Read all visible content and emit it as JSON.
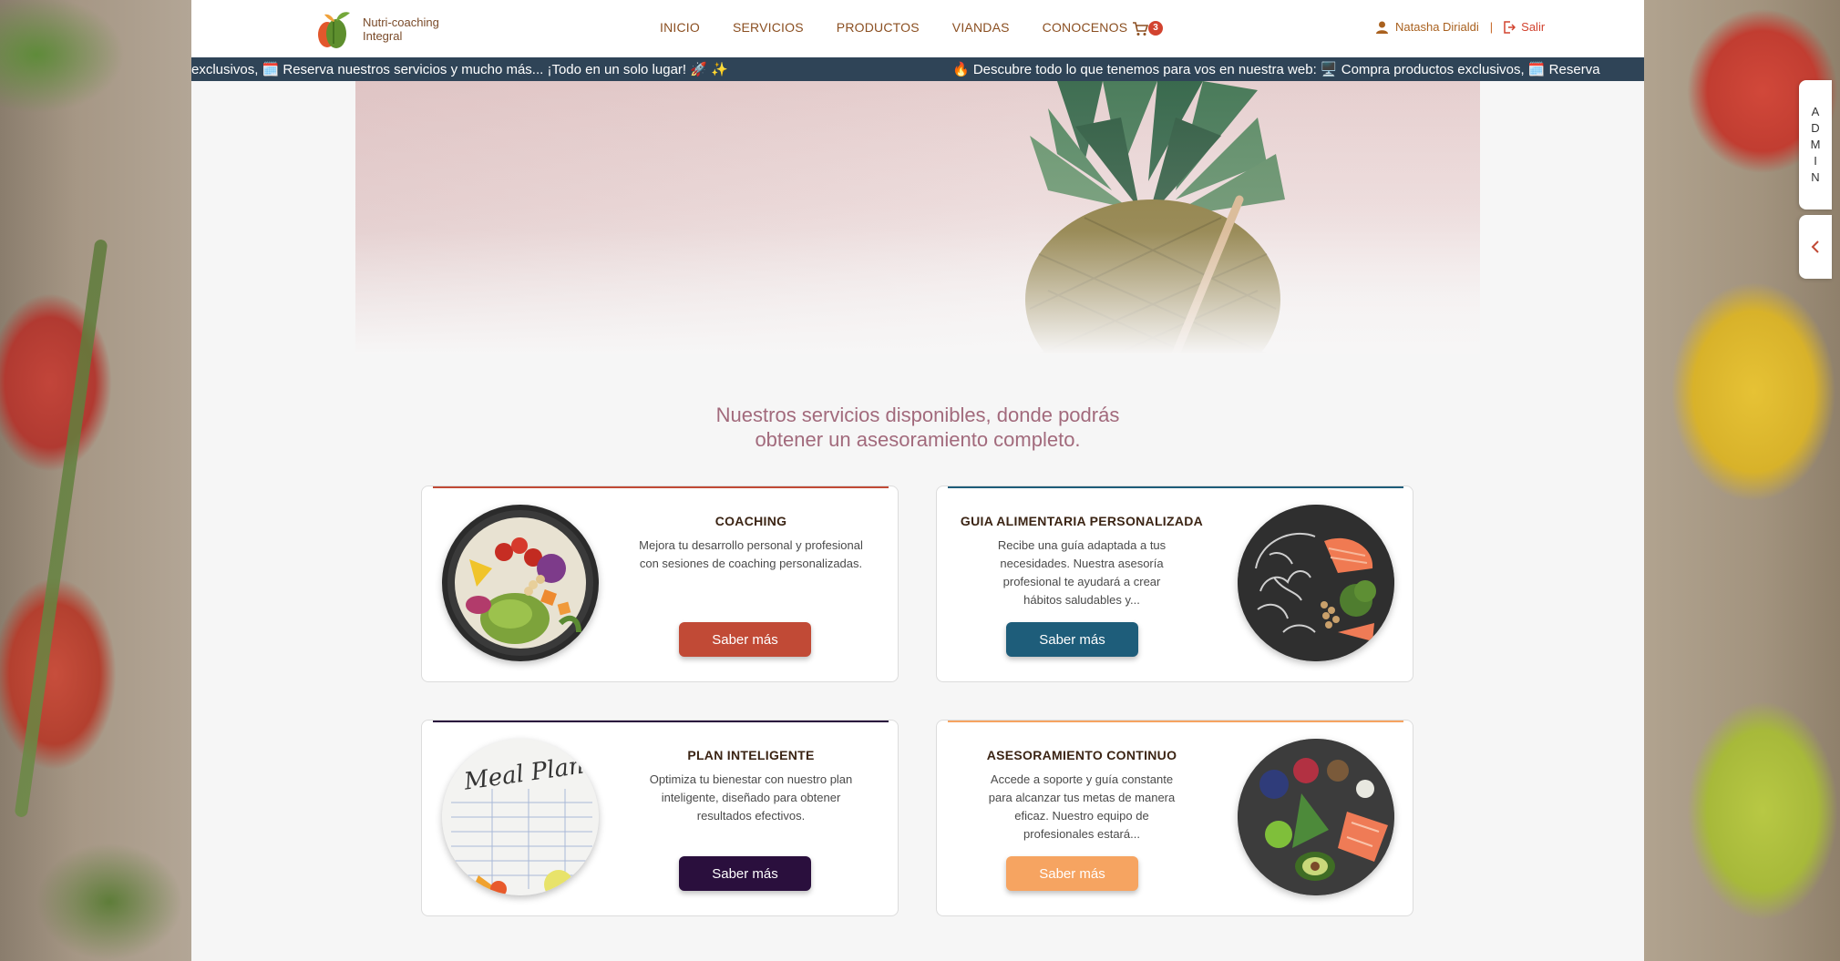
{
  "brand": {
    "name_line1": "Nutri-coaching",
    "name_line2": "Integral"
  },
  "nav": {
    "items": [
      {
        "label": "INICIO"
      },
      {
        "label": "SERVICIOS"
      },
      {
        "label": "PRODUCTOS"
      },
      {
        "label": "VIANDAS"
      },
      {
        "label": "CONOCENOS"
      }
    ],
    "cart_count": "3",
    "cart_icon": "shopping-cart-icon"
  },
  "user": {
    "name": "Natasha Dirialdi",
    "separator": "|",
    "logout_label": "Salir",
    "user_icon": "user-icon",
    "logout_icon": "logout-icon"
  },
  "ticker": {
    "segment_a": "exclusivos, 🗓️ Reserva nuestros servicios y mucho más... ¡Todo en un solo lugar! 🚀 ✨",
    "segment_b": "🔥 Descubre todo lo que tenemos para vos en nuestra web: 🖥️ Compra productos exclusivos, 🗓️ Reserva"
  },
  "section": {
    "title_line1": "Nuestros servicios disponibles, donde podrás",
    "title_line2": "obtener un asesoramiento completo."
  },
  "cards": [
    {
      "title": "COACHING",
      "description": "Mejora tu desarrollo personal y profesional con sesiones de coaching personalizadas.",
      "button": "Saber más",
      "accent": "#c14a36",
      "image": "salad-bowl-image"
    },
    {
      "title": "GUIA ALIMENTARIA PERSONALIZADA",
      "description": "Recibe una guía adaptada a tus necesidades. Nuestra asesoría profesional te ayudará a crear hábitos saludables y...",
      "button": "Saber más",
      "accent": "#1e5d7a",
      "image": "brain-food-image"
    },
    {
      "title": "PLAN INTELIGENTE",
      "description": "Optimiza tu bienestar con nuestro plan inteligente, diseñado para obtener resultados efectivos.",
      "button": "Saber más",
      "accent": "#2a0f3d",
      "image": "meal-plan-image",
      "image_text": "Meal Plan"
    },
    {
      "title": "ASESORAMIENTO CONTINUO",
      "description": "Accede a soporte y guía constante para alcanzar tus metas de manera eficaz. Nuestro equipo de profesionales estará...",
      "button": "Saber más",
      "accent": "#f6a461",
      "image": "healthy-food-image"
    }
  ],
  "admin": {
    "letters": [
      "A",
      "D",
      "M",
      "I",
      "N"
    ],
    "collapse_icon": "chevron-left-icon"
  },
  "colors": {
    "ticker_bg": "#2f4457",
    "nav_text": "#8b4f21",
    "title_color": "#a26a7c",
    "cart_badge": "#d2432f"
  }
}
